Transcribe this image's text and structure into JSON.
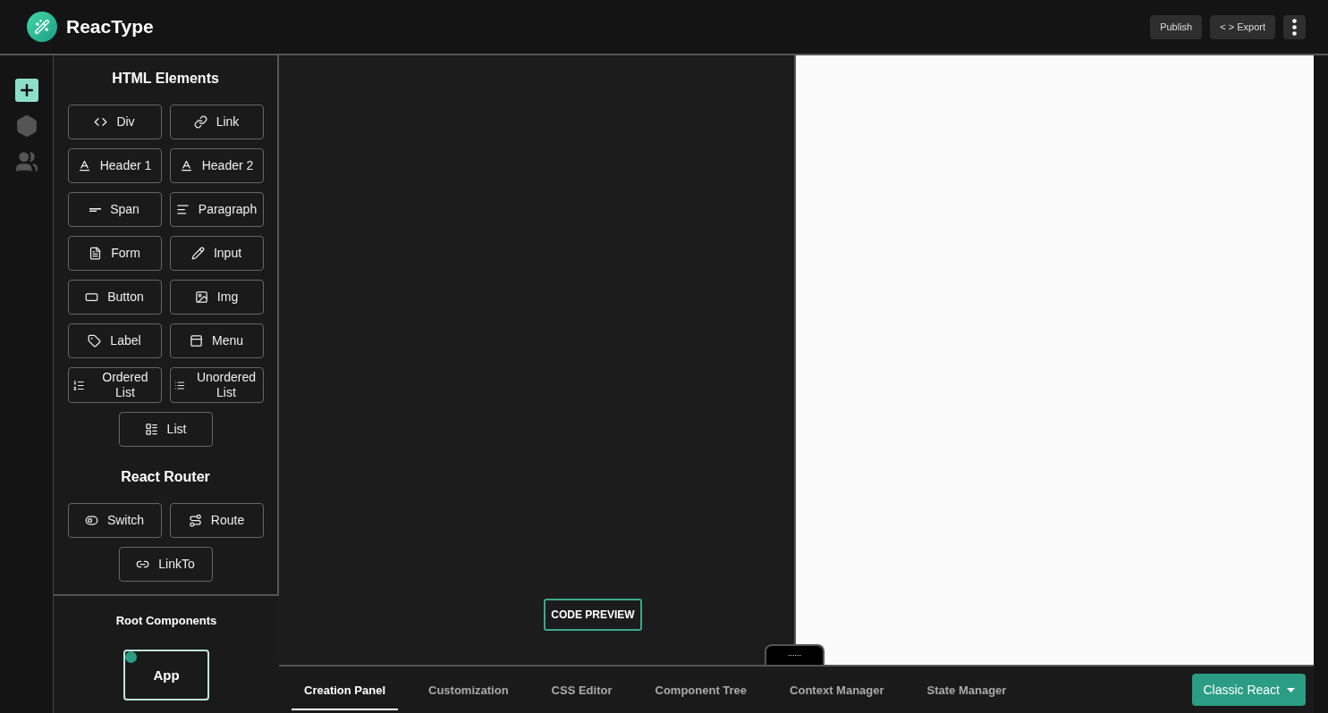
{
  "header": {
    "title": "ReacType",
    "actions": [
      {
        "label": "Publish"
      },
      {
        "label": "< > Export"
      }
    ]
  },
  "rail": [
    {
      "selected": true
    },
    {
      "selected": false
    },
    {
      "selected": false
    }
  ],
  "html_elements": {
    "title": "HTML Elements",
    "items": [
      "Div",
      "Link",
      "Header 1",
      "Header 2",
      "Span",
      "Paragraph",
      "Form",
      "Input",
      "Button",
      "Img",
      "Label",
      "Menu",
      "Ordered List",
      "Unordered List",
      "List"
    ]
  },
  "react_router": {
    "title": "React Router",
    "items": [
      "Switch",
      "Route",
      "LinkTo"
    ]
  },
  "root_components": {
    "title": "Root Components",
    "items": [
      {
        "label": "App"
      }
    ]
  },
  "canvas": {
    "code_preview": "CODE PREVIEW",
    "handle": "......"
  },
  "tabs": [
    {
      "label": "Creation Panel",
      "selected": true
    },
    {
      "label": "Customization",
      "selected": false
    },
    {
      "label": "CSS Editor",
      "selected": false
    },
    {
      "label": "Component Tree",
      "selected": false
    },
    {
      "label": "Context Manager",
      "selected": false
    },
    {
      "label": "State Manager",
      "selected": false
    }
  ],
  "mode_select": {
    "value": "Classic React"
  }
}
